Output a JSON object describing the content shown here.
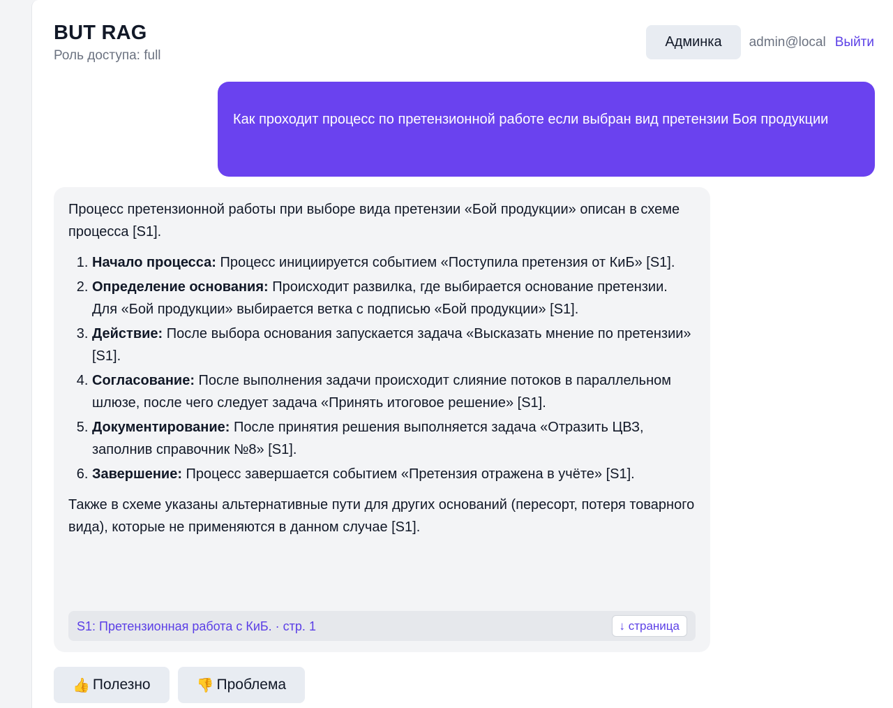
{
  "header": {
    "title": "BUT RAG",
    "role_label": "Роль доступа: full",
    "admin_button": "Админка",
    "user_email": "admin@local",
    "logout": "Выйти"
  },
  "chat": {
    "user_message": "Как проходит процесс по претензионной работе если выбран вид претензии Боя продукции",
    "answer": {
      "intro": "Процесс претензионной работы при выборе вида претензии «Бой продукции» описан в схеме процесса [S1].",
      "steps": [
        {
          "title": "Начало процесса:",
          "text": " Процесс инициируется событием «Поступила претензия от КиБ» [S1]."
        },
        {
          "title": "Определение основания:",
          "text": " Происходит развилка, где выбирается основание претензии. Для «Бой продукции» выбирается ветка с подписью «Бой продукции» [S1]."
        },
        {
          "title": "Действие:",
          "text": " После выбора основания запускается задача «Высказать мнение по претензии» [S1]."
        },
        {
          "title": "Согласование:",
          "text": " После выполнения задачи происходит слияние потоков в параллельном шлюзе, после чего следует задача «Принять итоговое решение» [S1]."
        },
        {
          "title": "Документирование:",
          "text": " После принятия решения выполняется задача «Отразить ЦВЗ, заполнив справочник №8» [S1]."
        },
        {
          "title": "Завершение:",
          "text": " Процесс завершается событием «Претензия отражена в учёте» [S1]."
        }
      ],
      "outro": "Также в схеме указаны альтернативные пути для других оснований (пересорт, потеря товарного вида), которые не применяются в данном случае [S1].",
      "source": {
        "label": "S1: Претензионная работа с КиБ. · стр. 1",
        "page_button": "↓ страница"
      }
    }
  },
  "feedback": {
    "useful": {
      "icon": "thumbs-up-icon",
      "glyph": "👍",
      "label": "Полезно"
    },
    "problem": {
      "icon": "thumbs-down-icon",
      "glyph": "👎",
      "label": "Проблема"
    }
  }
}
